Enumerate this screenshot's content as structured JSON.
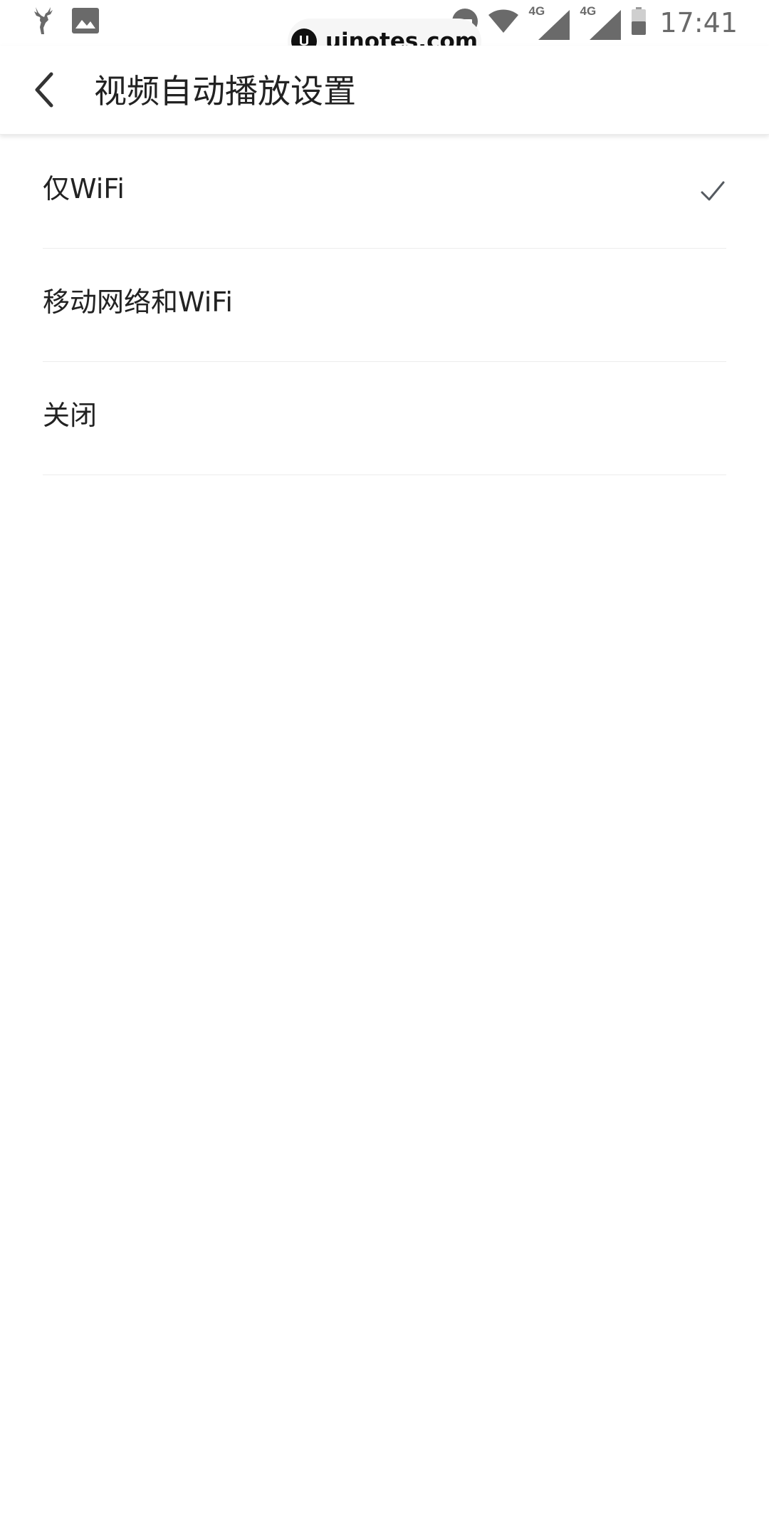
{
  "status_bar": {
    "time": "17:41",
    "network_1": "4G",
    "network_2": "4G",
    "left_icons": [
      "deer-logo-icon",
      "image-icon"
    ],
    "right_icons": [
      "do-not-disturb-icon",
      "wifi-icon",
      "signal-icon",
      "signal-icon",
      "battery-icon"
    ]
  },
  "watermark": {
    "text": "uinotes.com"
  },
  "header": {
    "back_icon": "chevron-left-icon",
    "title": "视频自动播放设置"
  },
  "options": [
    {
      "label": "仅WiFi",
      "selected": true
    },
    {
      "label": "移动网络和WiFi",
      "selected": false
    },
    {
      "label": "关闭",
      "selected": false
    }
  ],
  "colors": {
    "text": "#222222",
    "status_icons": "#6a6a6a",
    "divider": "#ececec",
    "check": "#555a60"
  }
}
